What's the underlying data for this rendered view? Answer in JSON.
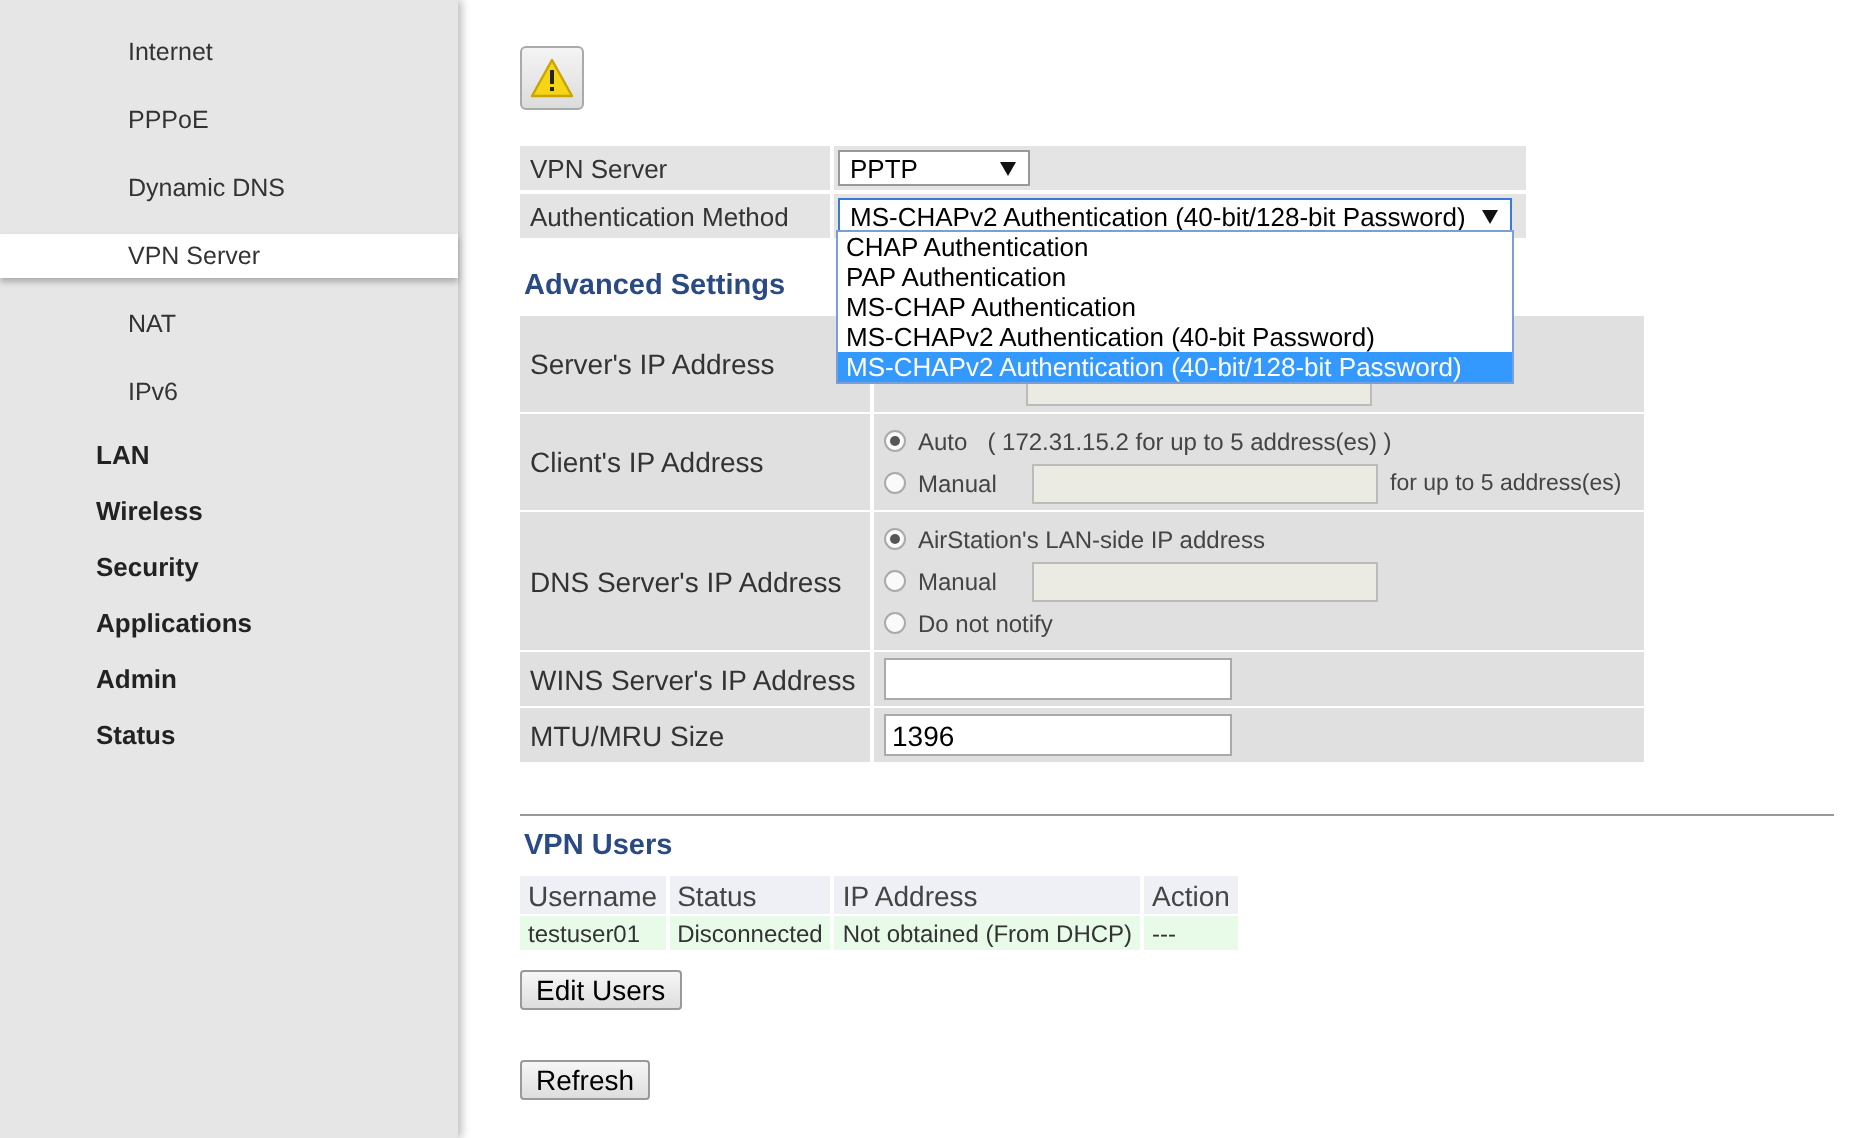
{
  "sidebar": {
    "items": [
      {
        "label": "Internet",
        "kind": "subitem",
        "selected": false
      },
      {
        "label": "PPPoE",
        "kind": "subitem",
        "selected": false
      },
      {
        "label": "Dynamic DNS",
        "kind": "subitem",
        "selected": false
      },
      {
        "label": "VPN Server",
        "kind": "subitem",
        "selected": true
      },
      {
        "label": "NAT",
        "kind": "subitem",
        "selected": false
      },
      {
        "label": "IPv6",
        "kind": "subitem",
        "selected": false
      },
      {
        "label": "LAN",
        "kind": "section",
        "selected": false
      },
      {
        "label": "Wireless",
        "kind": "section",
        "selected": false
      },
      {
        "label": "Security",
        "kind": "section",
        "selected": false
      },
      {
        "label": "Applications",
        "kind": "section",
        "selected": false
      },
      {
        "label": "Admin",
        "kind": "section",
        "selected": false
      },
      {
        "label": "Status",
        "kind": "section",
        "selected": false
      }
    ]
  },
  "basic_settings": [
    {
      "label": "VPN Server",
      "value": "PPTP",
      "kind": "select"
    },
    {
      "label": "Authentication Method",
      "value": "MS-CHAPv2 Authentication (40-bit/128-bit Password)",
      "kind": "select",
      "expanded": true,
      "options": [
        {
          "label": "CHAP Authentication",
          "selected": false
        },
        {
          "label": "PAP Authentication",
          "selected": false
        },
        {
          "label": "MS-CHAP Authentication",
          "selected": false
        },
        {
          "label": "MS-CHAPv2 Authentication (40-bit Password)",
          "selected": false
        },
        {
          "label": "MS-CHAPv2 Authentication (40-bit/128-bit Password)",
          "selected": true
        }
      ]
    }
  ],
  "advanced_settings": {
    "title": "Advanced Settings",
    "rows": [
      {
        "label": "Server's IP Address",
        "kind": "covered"
      },
      {
        "label": "Client's IP Address",
        "kind": "radios",
        "options": [
          {
            "label": "Auto",
            "note": "( 172.31.15.2 for up to 5 address(es) )",
            "selected": true
          },
          {
            "label": "Manual",
            "field": true,
            "suffix": "for up to 5 address(es)",
            "selected": false
          }
        ]
      },
      {
        "label": "DNS Server's IP Address",
        "kind": "radios",
        "options": [
          {
            "label": "AirStation's LAN-side IP address",
            "selected": true
          },
          {
            "label": "Manual",
            "field": true,
            "selected": false
          },
          {
            "label": "Do not notify",
            "selected": false
          }
        ]
      },
      {
        "label": "WINS Server's IP Address",
        "kind": "text"
      },
      {
        "label": "MTU/MRU Size",
        "kind": "text",
        "value": "1396"
      }
    ]
  },
  "vpn_users": {
    "title": "VPN Users",
    "columns": [
      "Username",
      "Status",
      "IP Address",
      "Action"
    ],
    "rows": [
      [
        "testuser01",
        "Disconnected",
        "Not obtained (From DHCP)",
        "---"
      ]
    ]
  },
  "buttons": [
    "Edit Users",
    "Refresh"
  ]
}
